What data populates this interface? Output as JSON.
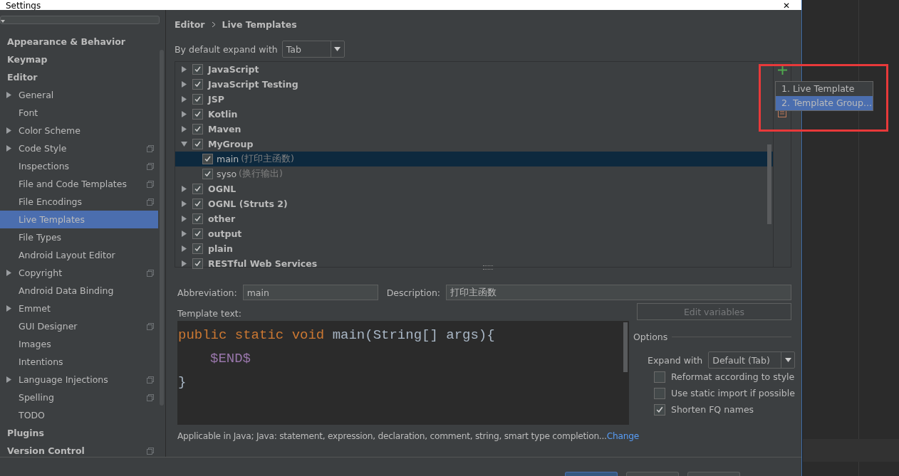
{
  "window": {
    "title": "Settings",
    "close": "✕"
  },
  "sidebar": {
    "items": [
      {
        "label": "Appearance & Behavior",
        "kind": "section",
        "expandable": false,
        "project_icon": false,
        "selected": false
      },
      {
        "label": "Keymap",
        "kind": "section",
        "expandable": false,
        "project_icon": false,
        "selected": false
      },
      {
        "label": "Editor",
        "kind": "section",
        "expandable": false,
        "project_icon": false,
        "selected": false
      },
      {
        "label": "General",
        "kind": "page",
        "expandable": true,
        "project_icon": false,
        "selected": false
      },
      {
        "label": "Font",
        "kind": "page",
        "expandable": false,
        "project_icon": false,
        "selected": false
      },
      {
        "label": "Color Scheme",
        "kind": "page",
        "expandable": true,
        "project_icon": false,
        "selected": false
      },
      {
        "label": "Code Style",
        "kind": "page",
        "expandable": true,
        "project_icon": true,
        "selected": false
      },
      {
        "label": "Inspections",
        "kind": "page",
        "expandable": false,
        "project_icon": true,
        "selected": false
      },
      {
        "label": "File and Code Templates",
        "kind": "page",
        "expandable": false,
        "project_icon": true,
        "selected": false
      },
      {
        "label": "File Encodings",
        "kind": "page",
        "expandable": false,
        "project_icon": true,
        "selected": false
      },
      {
        "label": "Live Templates",
        "kind": "page",
        "expandable": false,
        "project_icon": false,
        "selected": true
      },
      {
        "label": "File Types",
        "kind": "page",
        "expandable": false,
        "project_icon": false,
        "selected": false
      },
      {
        "label": "Android Layout Editor",
        "kind": "page",
        "expandable": false,
        "project_icon": false,
        "selected": false
      },
      {
        "label": "Copyright",
        "kind": "page",
        "expandable": true,
        "project_icon": true,
        "selected": false
      },
      {
        "label": "Android Data Binding",
        "kind": "page",
        "expandable": false,
        "project_icon": false,
        "selected": false
      },
      {
        "label": "Emmet",
        "kind": "page",
        "expandable": true,
        "project_icon": false,
        "selected": false
      },
      {
        "label": "GUI Designer",
        "kind": "page",
        "expandable": false,
        "project_icon": true,
        "selected": false
      },
      {
        "label": "Images",
        "kind": "page",
        "expandable": false,
        "project_icon": false,
        "selected": false
      },
      {
        "label": "Intentions",
        "kind": "page",
        "expandable": false,
        "project_icon": false,
        "selected": false
      },
      {
        "label": "Language Injections",
        "kind": "page",
        "expandable": true,
        "project_icon": true,
        "selected": false
      },
      {
        "label": "Spelling",
        "kind": "page",
        "expandable": false,
        "project_icon": true,
        "selected": false
      },
      {
        "label": "TODO",
        "kind": "page",
        "expandable": false,
        "project_icon": false,
        "selected": false
      },
      {
        "label": "Plugins",
        "kind": "section",
        "expandable": false,
        "project_icon": false,
        "selected": false
      },
      {
        "label": "Version Control",
        "kind": "section",
        "expandable": false,
        "project_icon": true,
        "selected": false
      }
    ]
  },
  "breadcrumb": [
    "Editor",
    "Live Templates"
  ],
  "expand_default": {
    "label": "By default expand with",
    "value": "Tab"
  },
  "tree": [
    {
      "label": "JavaScript",
      "checked": true,
      "expanded": false
    },
    {
      "label": "JavaScript Testing",
      "checked": true,
      "expanded": false
    },
    {
      "label": "JSP",
      "checked": true,
      "expanded": false
    },
    {
      "label": "Kotlin",
      "checked": true,
      "expanded": false
    },
    {
      "label": "Maven",
      "checked": true,
      "expanded": false
    },
    {
      "label": "MyGroup",
      "checked": true,
      "expanded": true,
      "children": [
        {
          "abbreviation": "main",
          "description": "(打印主函数)",
          "checked": true,
          "selected": true
        },
        {
          "abbreviation": "syso",
          "description": "(换行输出)",
          "checked": true,
          "selected": false
        }
      ]
    },
    {
      "label": "OGNL",
      "checked": true,
      "expanded": false
    },
    {
      "label": "OGNL (Struts 2)",
      "checked": true,
      "expanded": false
    },
    {
      "label": "other",
      "checked": true,
      "expanded": false
    },
    {
      "label": "output",
      "checked": true,
      "expanded": false
    },
    {
      "label": "plain",
      "checked": true,
      "expanded": false
    },
    {
      "label": "RESTful Web Services",
      "checked": true,
      "expanded": false
    }
  ],
  "add_menu": [
    {
      "number": "1.",
      "label": "Live Template",
      "selected": false
    },
    {
      "number": "2.",
      "label": "Template Group...",
      "selected": true
    }
  ],
  "abbreviation": {
    "label": "Abbreviation:",
    "value": "main"
  },
  "description": {
    "label": "Description:",
    "value": "打印主函数"
  },
  "template_label": "Template text:",
  "code": [
    {
      "indented": false,
      "tokens": [
        {
          "kind": "keyword",
          "text": "public static void "
        },
        {
          "kind": "plain",
          "text": "main(String[] args){"
        }
      ]
    },
    {
      "indented": true,
      "tokens": [
        {
          "kind": "variable",
          "text": "$END$"
        }
      ]
    },
    {
      "indented": false,
      "tokens": [
        {
          "kind": "plain",
          "text": "}"
        }
      ]
    }
  ],
  "applicable": {
    "text": "Applicable in Java; Java: statement, expression, declaration, comment, string, smart type completion...",
    "link": "Change"
  },
  "edit_variables": {
    "label": "Edit variables",
    "disabled": true
  },
  "options": {
    "title": "Options",
    "expand_with": {
      "label": "Expand with",
      "value": "Default (Tab)"
    },
    "checks": [
      {
        "label": "Reformat according to style",
        "checked": false
      },
      {
        "label": "Use static import if possible",
        "checked": false
      },
      {
        "label": "Shorten FQ names",
        "checked": true
      }
    ]
  }
}
